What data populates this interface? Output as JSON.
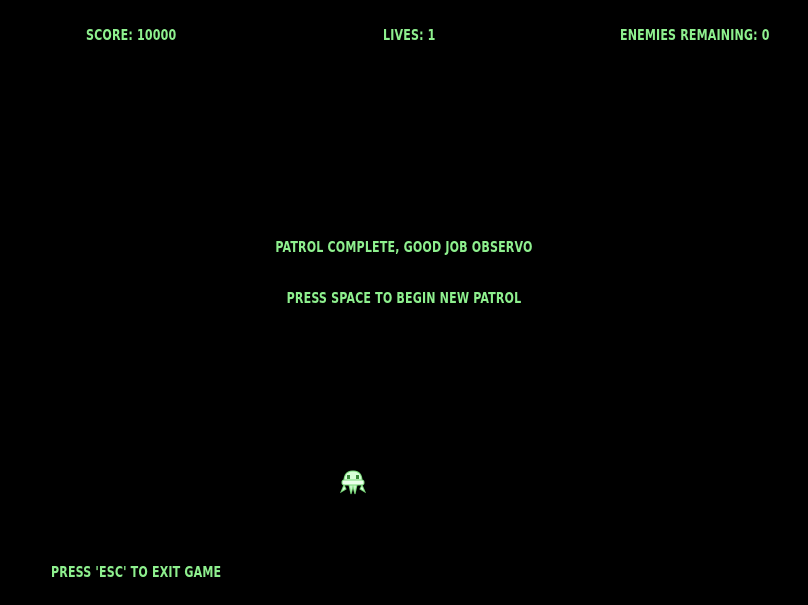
{
  "hud": {
    "score": "SCORE: 10000",
    "lives": "LIVES: 1",
    "enemies": "ENEMIES REMAINING: 0"
  },
  "messages": {
    "complete": "PATROL COMPLETE, GOOD JOB OBSERVO",
    "prompt": "PRESS SPACE TO BEGIN NEW PATROL"
  },
  "footer": {
    "exit_hint": "PRESS 'ESC' TO EXIT GAME"
  },
  "player": {
    "icon": "alien-ship-icon"
  },
  "colors": {
    "text": "#8ef08e",
    "background": "#000000"
  }
}
